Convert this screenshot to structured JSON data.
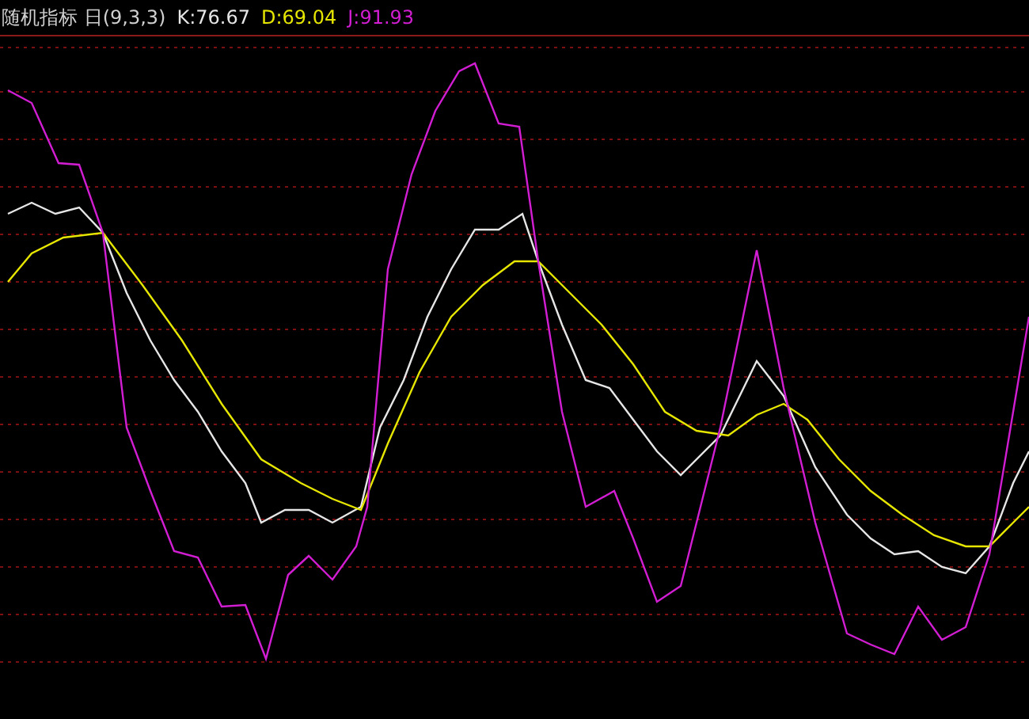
{
  "indicator": {
    "title": "随机指标 日(9,3,3)",
    "readings": [
      {
        "text": "K:76.67",
        "color": "#e6e6e6"
      },
      {
        "text": "D:69.04",
        "color": "#e6e600"
      },
      {
        "text": "J:91.93",
        "color": "#d21ed2"
      }
    ]
  }
}
